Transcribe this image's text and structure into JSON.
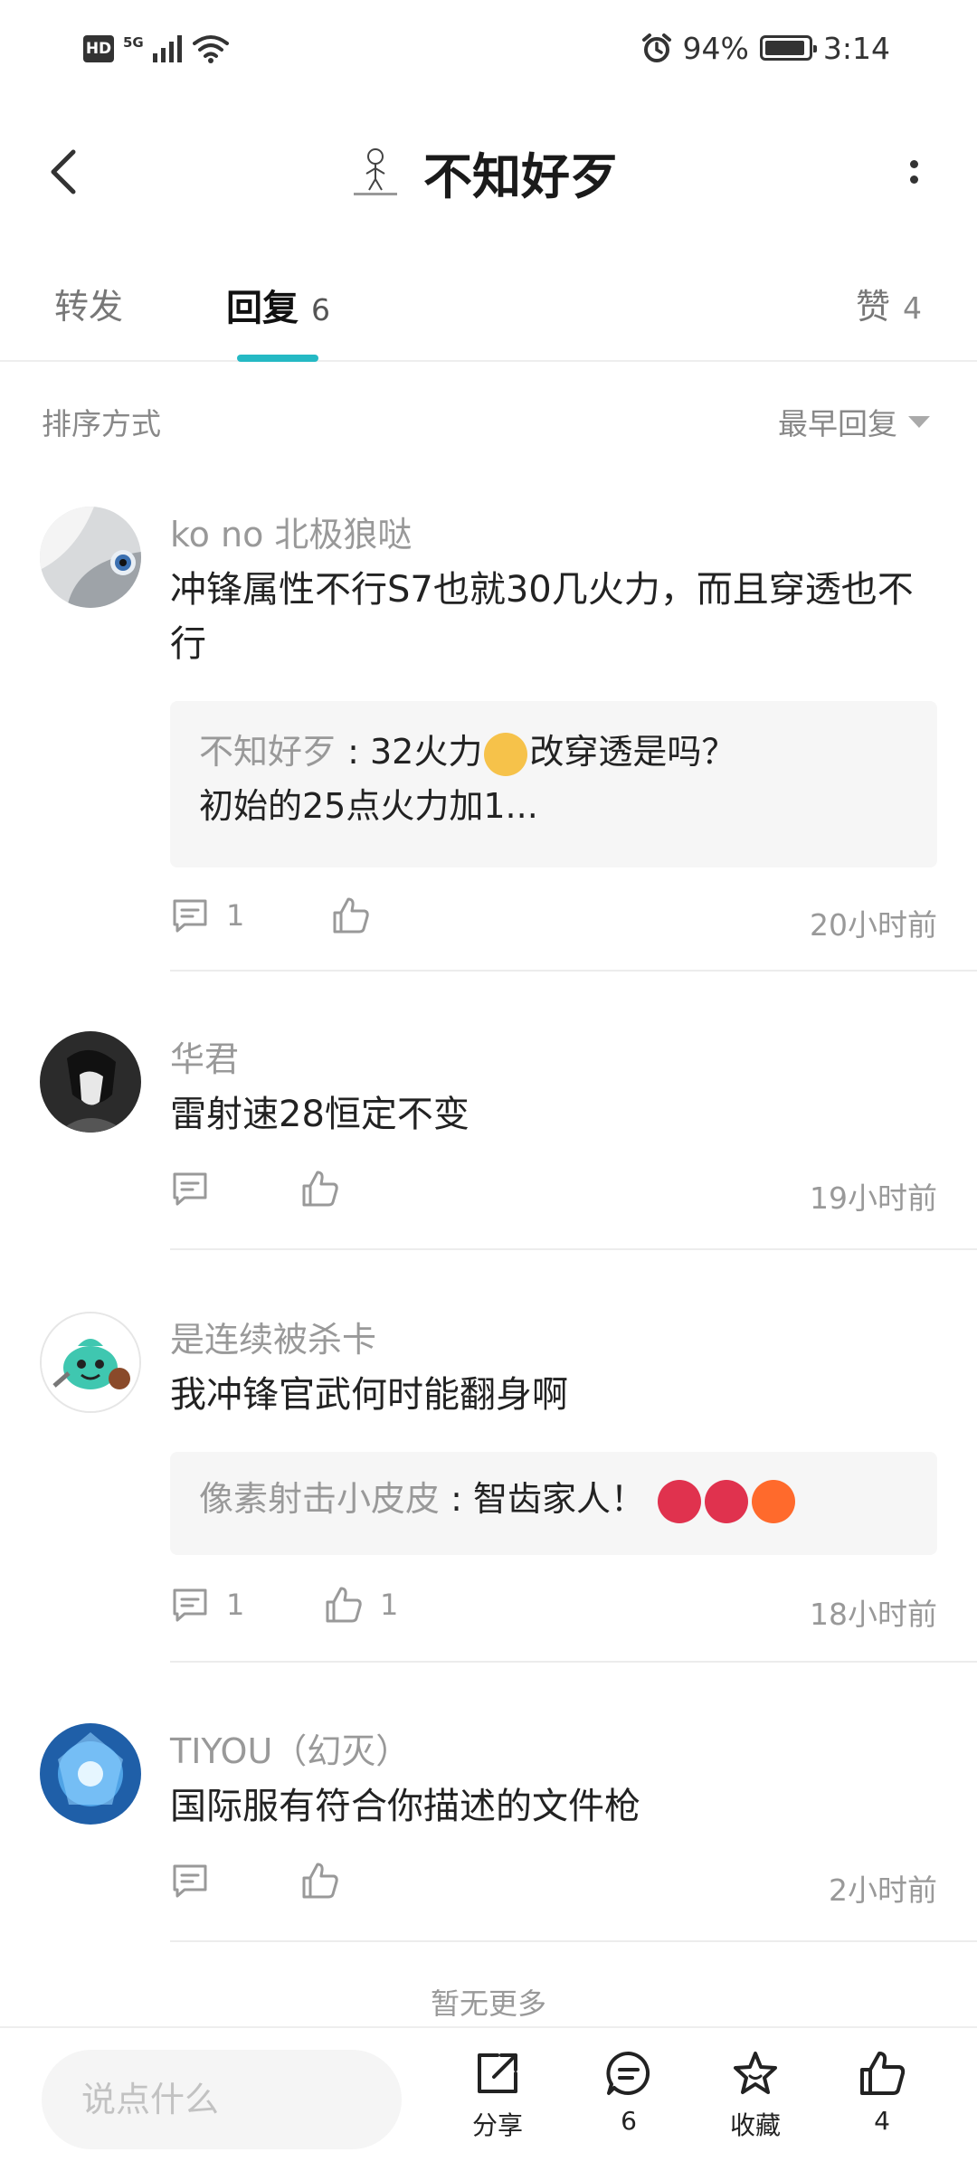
{
  "status_bar": {
    "hd": "HD",
    "network": "5G",
    "battery_text": "94%",
    "battery_level": 0.94,
    "time": "3:14"
  },
  "header": {
    "title": "不知好歹"
  },
  "tabs": [
    {
      "label": "转发",
      "count": ""
    },
    {
      "label": "回复",
      "count": "6"
    },
    {
      "label": "赞",
      "count": "4"
    }
  ],
  "sort": {
    "label": "排序方式",
    "value": "最早回复"
  },
  "comments": [
    {
      "name": "ko no 北极狼哒",
      "text": "冲锋属性不行S7也就30几火力，而且穿透也不行",
      "reply_author": "不知好歹",
      "reply_sep": " : ",
      "reply_text_1": "32火力",
      "reply_text_2": "改穿透是吗？",
      "reply_text_3": "初始的25点火力加1...",
      "reply_count": "1",
      "like_count": "",
      "time": "20小时前"
    },
    {
      "name": "华君",
      "text": "雷射速28恒定不变",
      "reply_count": "",
      "like_count": "",
      "time": "19小时前"
    },
    {
      "name": "是连续被杀卡",
      "text": "我冲锋官武何时能翻身啊",
      "reply_author": "像素射击小皮皮",
      "reply_sep": " : ",
      "reply_text_1": "智齿家人！",
      "reply_count": "1",
      "like_count": "1",
      "time": "18小时前"
    },
    {
      "name": "TIYOU（幻灭）",
      "text": "国际服有符合你描述的文件枪",
      "reply_count": "",
      "like_count": "",
      "time": "2小时前"
    }
  ],
  "no_more": "暂无更多",
  "bottom_bar": {
    "input_placeholder": "说点什么",
    "share_label": "分享",
    "comment_count": "6",
    "favorite_label": "收藏",
    "like_count": "4"
  },
  "icons": {
    "back": "chevron-left-icon",
    "more": "more-vertical-icon",
    "comment": "comment-icon",
    "like": "thumbs-up-icon",
    "share": "share-icon",
    "favorite": "star-icon"
  },
  "colors": {
    "accent": "#25b9c4"
  }
}
